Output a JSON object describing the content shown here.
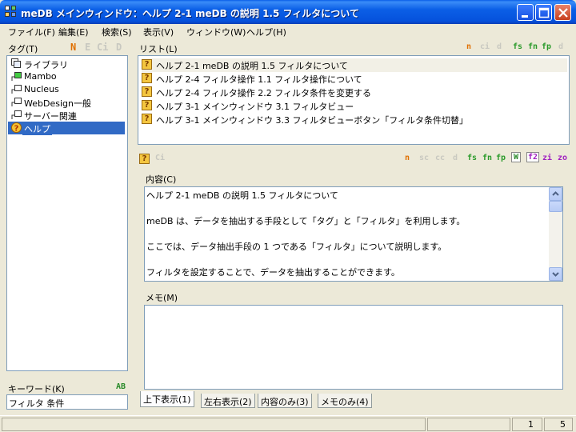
{
  "window": {
    "title": "meDB メインウィンドウ：ヘルプ 2-1 meDB の説明 1.5 フィルタについて",
    "buttons": [
      "minimize",
      "maximize",
      "close"
    ]
  },
  "menu": [
    "ファイル(F)",
    "編集(E)",
    "検索(S)",
    "表示(V)",
    "ウィンドウ(W)",
    "ヘルプ(H)"
  ],
  "tag_pane": {
    "label": "タグ(T)",
    "icons": [
      "N",
      "E",
      "Ci",
      "D"
    ],
    "items": [
      {
        "label": "ライブラリ",
        "icon": "library-icon"
      },
      {
        "label": "Mambo",
        "icon": "tag-icon"
      },
      {
        "label": "Nucleus",
        "icon": "tag-icon"
      },
      {
        "label": "WebDesign一般",
        "icon": "tag-icon"
      },
      {
        "label": "サーバー関連",
        "icon": "tag-icon"
      },
      {
        "label": "ヘルプ",
        "icon": "help-icon",
        "selected": true
      }
    ]
  },
  "keyword": {
    "label": "キーワード(K)",
    "icon_text": "AB",
    "value": "フィルタ 条件"
  },
  "list_pane": {
    "label": "リスト(L)",
    "icons": [
      "n",
      "ci",
      "d",
      "fs",
      "fn",
      "fp",
      "d"
    ],
    "rows": [
      "ヘルプ 2-1 meDB の説明 1.5 フィルタについて",
      "ヘルプ 2-4 フィルタ操作 1.1 フィルタ操作について",
      "ヘルプ 2-4 フィルタ操作 2.2 フィルタ条件を変更する",
      "ヘルプ 3-1 メインウィンドウ 3.1 フィルタビュー",
      "ヘルプ 3-1 メインウィンドウ 3.3 フィルタビューボタン「フィルタ条件切替」"
    ]
  },
  "detail_toolbar": {
    "left_icons": [
      "?",
      "Ci"
    ],
    "right_icons": [
      "n",
      "sc",
      "cc",
      "d",
      "fs",
      "fn",
      "fp",
      "W",
      "f2",
      "zi",
      "zo"
    ]
  },
  "content": {
    "label": "内容(C)",
    "lines": [
      "ヘルプ 2-1 meDB の説明 1.5 フィルタについて",
      "",
      "meDB は、データを抽出する手段として「タグ」と「フィルタ」を利用します。",
      "",
      "ここでは、データ抽出手段の 1 つである「フィルタ」について説明します。",
      "",
      "フィルタを設定することで、データを抽出することができます。"
    ]
  },
  "memo": {
    "label": "メモ(M)",
    "value": ""
  },
  "tabs": [
    "上下表示(1)",
    "左右表示(2)",
    "内容のみ(3)",
    "メモのみ(4)"
  ],
  "status": {
    "left": "1",
    "right": "5"
  },
  "colors": {
    "selection": "#316ac5",
    "accent_orange": "#e07000",
    "accent_green": "#2a9a2a"
  }
}
